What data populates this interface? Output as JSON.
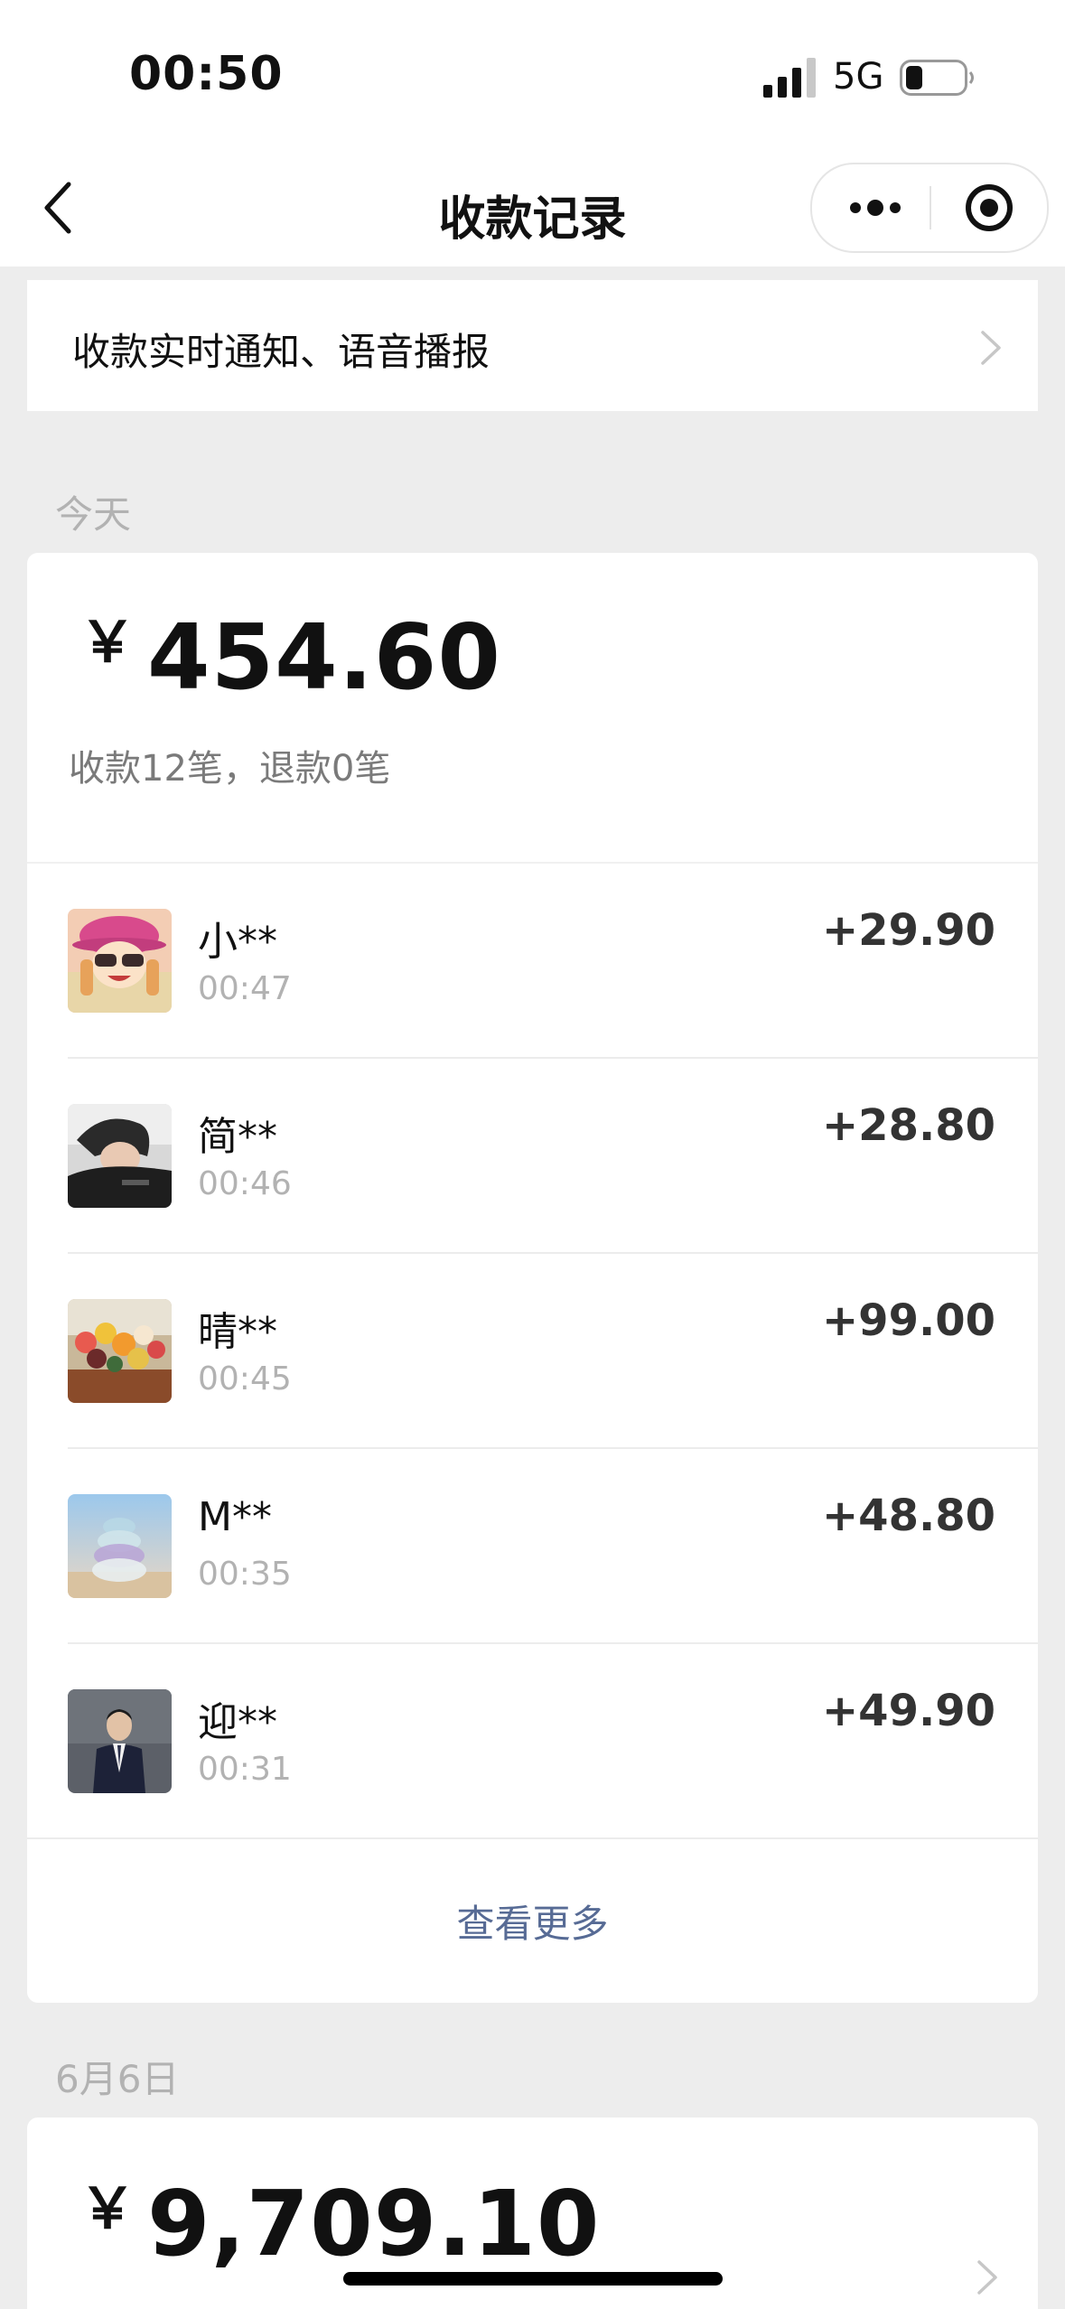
{
  "status_bar": {
    "time": "00:50",
    "network": "5G"
  },
  "nav": {
    "title": "收款记录"
  },
  "notify": {
    "label": "收款实时通知、语音播报"
  },
  "today": {
    "label": "今天",
    "currency": "￥",
    "total": "454.60",
    "summary": "收款12笔，退款0笔",
    "records": [
      {
        "name": "小**",
        "time": "00:47",
        "amount": "+29.90"
      },
      {
        "name": "简**",
        "time": "00:46",
        "amount": "+28.80"
      },
      {
        "name": "晴**",
        "time": "00:45",
        "amount": "+99.00"
      },
      {
        "name": "M**",
        "time": "00:35",
        "amount": "+48.80"
      },
      {
        "name": "迎**",
        "time": "00:31",
        "amount": "+49.90"
      }
    ],
    "view_more": "查看更多"
  },
  "prev_day": {
    "label": "6月6日",
    "currency": "￥",
    "total": "9,709.10"
  }
}
